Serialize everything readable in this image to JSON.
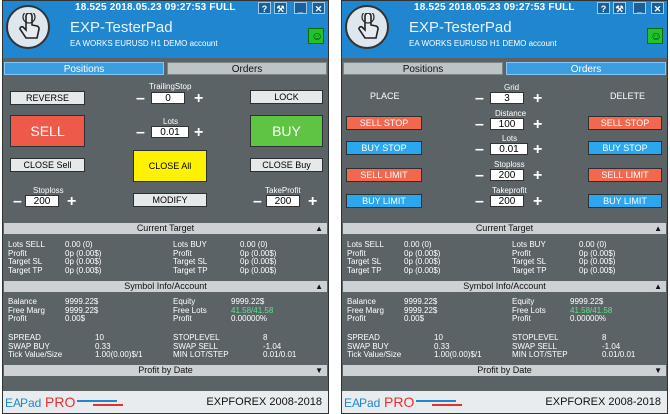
{
  "titlebar": {
    "text": "18.525  2018.05.23 09:27:53   FULL",
    "help": "?",
    "tools": "⚒",
    "min": "_",
    "close": "✕"
  },
  "header": {
    "title": "EXP-TesterPad",
    "subtitle": "EA WORKS EURUSD  H1 DEMO account",
    "smiley": "☺"
  },
  "tabs": {
    "positions": "Positions",
    "orders": "Orders"
  },
  "positions": {
    "reverse": "REVERSE",
    "trailing_label": "TrailingStop",
    "trailing_value": "0",
    "lock": "LOCK",
    "sell": "SELL",
    "lots_label": "Lots",
    "lots_value": "0.01",
    "buy": "BUY",
    "close_sell": "CLOSE Sell",
    "close_all": "CLOSE All",
    "close_buy": "CLOSE Buy",
    "stoploss_label": "Stoploss",
    "stoploss_value": "200",
    "modify": "MODIFY",
    "takeprofit_label": "TakeProfit",
    "takeprofit_value": "200"
  },
  "orders": {
    "place": "PLACE",
    "delete": "DELETE",
    "grid_label": "Grid",
    "grid_value": "3",
    "distance_label": "Distance",
    "distance_value": "100",
    "lots_label": "Lots",
    "lots_value": "0.01",
    "stoploss_label": "Stoploss",
    "stoploss_value": "200",
    "takeprofit_label": "Takeprofit",
    "takeprofit_value": "200",
    "sell_stop": "SELL STOP",
    "buy_stop": "BUY STOP",
    "sell_limit": "SELL LIMIT",
    "buy_limit": "BUY LIMIT"
  },
  "sections": {
    "current_target": "Current Target",
    "symbol_info": "Symbol Info/Account",
    "profit_by_date": "Profit by Date"
  },
  "current_target": {
    "left_labels": "Lots SELL\nProfit\nTarget SL\nTarget TP",
    "left_values": "0.00 (0)\n0p (0.00$)\n0p (0.00$)\n0p (0.00$)",
    "right_labels": "Lots BUY\nProfit\nTarget SL\nTarget TP",
    "right_values": "0.00 (0)\n0p (0.00$)\n0p (0.00$)\n0p (0.00$)"
  },
  "account": {
    "left_labels": "Balance\nFree Marg\nProfit",
    "left_values": "9999.22$\n9999.22$\n0.00$",
    "right_labels": "Equity\nFree Lots\nProfit",
    "right_values_1": "9999.22$",
    "right_values_2": "41.58/41.58",
    "right_values_3": "0.00000%"
  },
  "symbol": {
    "left_labels": "SPREAD\nSWAP BUY\nTick Value/Size",
    "left_values": "10\n0.33\n1.00(0.00)$/1",
    "right_labels": "STOPLEVEL\nSWAP SELL\nMIN LOT/STEP",
    "right_values": "8\n-1.04\n0.01/0.01"
  },
  "footer": {
    "ea": "EA",
    "pad": "Pad",
    "pro": "PRO",
    "copyright": "EXPFOREX 2008-2018"
  },
  "colors": {
    "title_bar": "#1f86cf",
    "panel_bg": "#5b6366",
    "sell": "#ee5a4a",
    "buy": "#5fc444",
    "close_all": "#fff200",
    "blue_btn": "#2ca7ee"
  }
}
